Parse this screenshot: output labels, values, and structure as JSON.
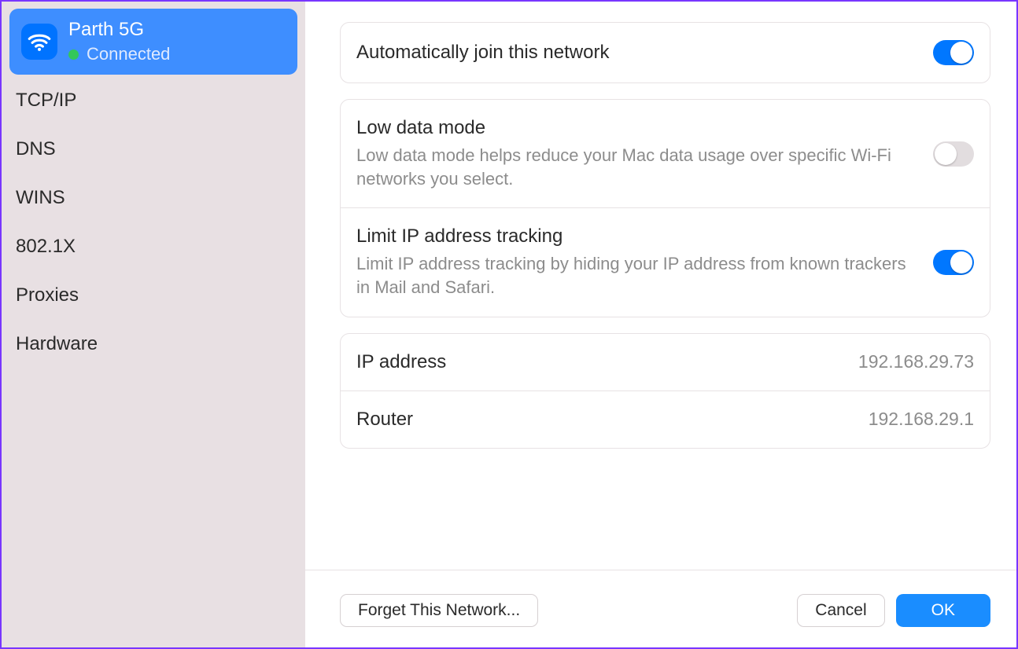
{
  "sidebar": {
    "network": {
      "name": "Parth 5G",
      "status": "Connected"
    },
    "items": [
      "TCP/IP",
      "DNS",
      "WINS",
      "802.1X",
      "Proxies",
      "Hardware"
    ]
  },
  "settings": {
    "autoJoin": {
      "label": "Automatically join this network",
      "on": true
    },
    "lowData": {
      "label": "Low data mode",
      "desc": "Low data mode helps reduce your Mac data usage over specific Wi-Fi networks you select.",
      "on": false
    },
    "limitTracking": {
      "label": "Limit IP address tracking",
      "desc": "Limit IP address tracking by hiding your IP address from known trackers in Mail and Safari.",
      "on": true
    }
  },
  "info": {
    "ip": {
      "label": "IP address",
      "value": "192.168.29.73"
    },
    "router": {
      "label": "Router",
      "value": "192.168.29.1"
    }
  },
  "footer": {
    "forget": "Forget This Network...",
    "cancel": "Cancel",
    "ok": "OK"
  }
}
